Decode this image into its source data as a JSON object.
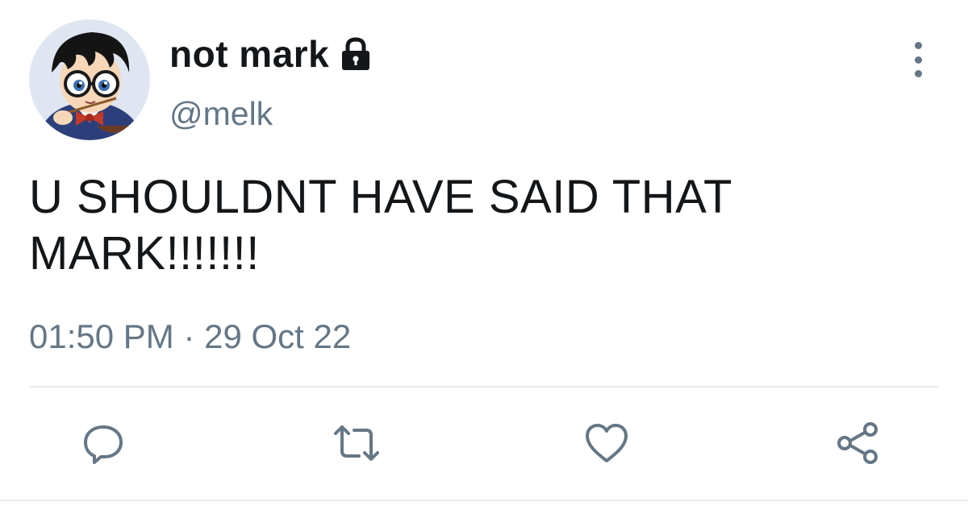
{
  "user": {
    "display_name": "not mark",
    "handle": "@melk",
    "protected_icon": "lock-icon",
    "avatar_icon": "anime-avatar"
  },
  "tweet": {
    "text_line1": "U SHOULDNT HAVE SAID THAT",
    "text_line2": "MARK!!!!!!!",
    "time": "01:50 PM",
    "separator": "·",
    "date": "29 Oct 22"
  },
  "actions": [
    {
      "icon": "reply-icon"
    },
    {
      "icon": "retweet-icon"
    },
    {
      "icon": "like-icon"
    },
    {
      "icon": "share-icon"
    }
  ],
  "colors": {
    "text": "#14171a",
    "secondary": "#657786",
    "divider": "#e6ecf0"
  }
}
